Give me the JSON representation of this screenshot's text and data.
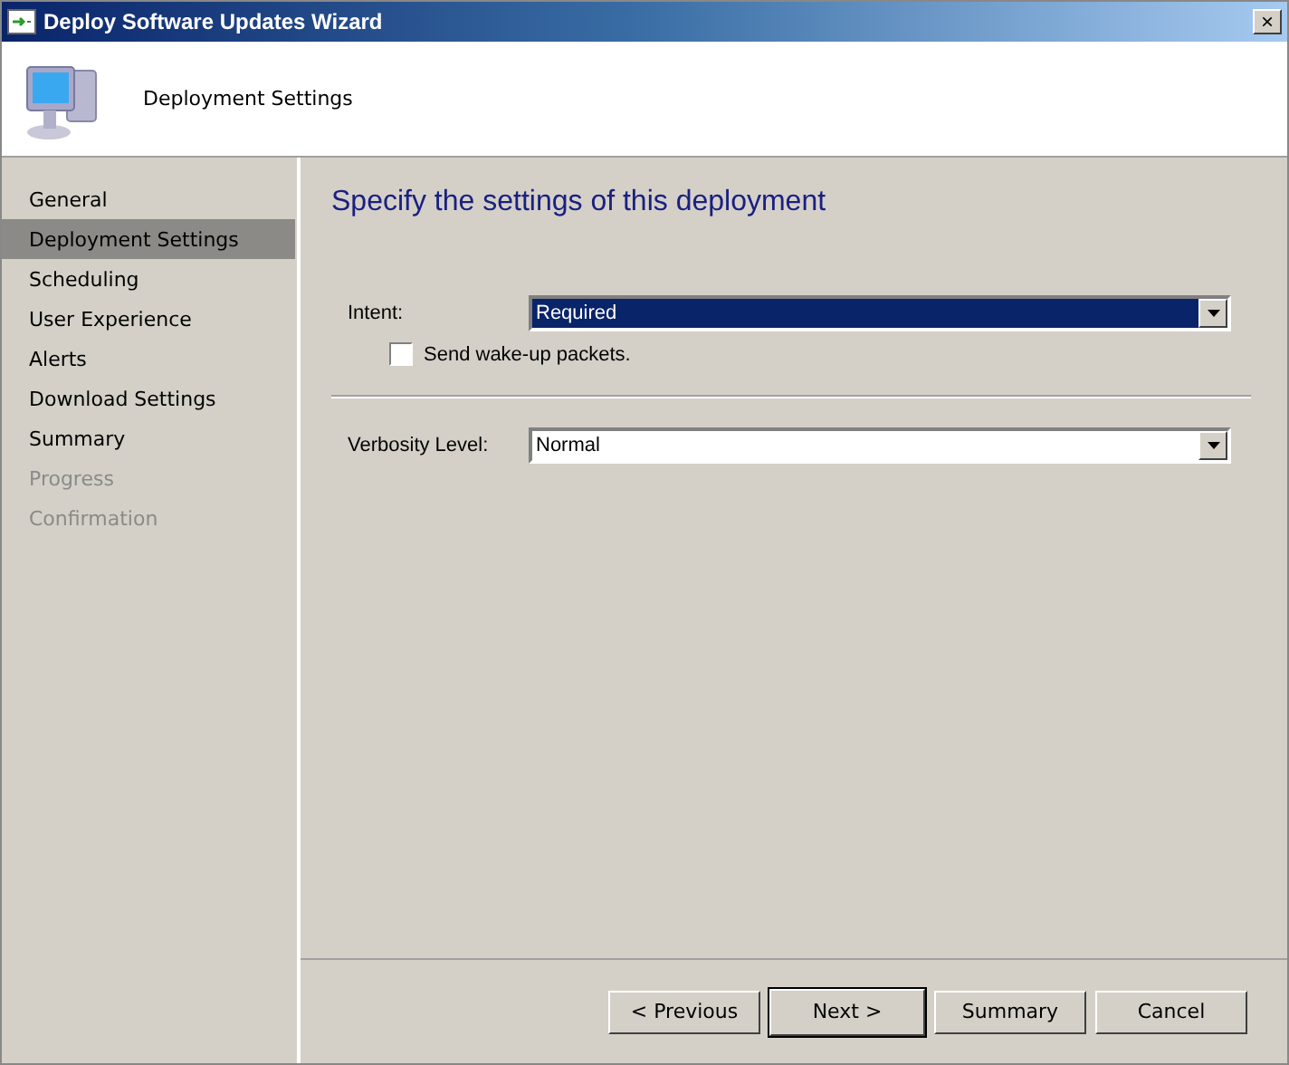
{
  "window": {
    "title": "Deploy Software Updates Wizard",
    "close": "×"
  },
  "header": {
    "title": "Deployment Settings"
  },
  "sidebar": {
    "items": [
      {
        "label": "General",
        "selected": false,
        "disabled": false
      },
      {
        "label": "Deployment Settings",
        "selected": true,
        "disabled": false
      },
      {
        "label": "Scheduling",
        "selected": false,
        "disabled": false
      },
      {
        "label": "User Experience",
        "selected": false,
        "disabled": false
      },
      {
        "label": "Alerts",
        "selected": false,
        "disabled": false
      },
      {
        "label": "Download Settings",
        "selected": false,
        "disabled": false
      },
      {
        "label": "Summary",
        "selected": false,
        "disabled": false
      },
      {
        "label": "Progress",
        "selected": false,
        "disabled": true
      },
      {
        "label": "Confirmation",
        "selected": false,
        "disabled": true
      }
    ]
  },
  "page": {
    "heading": "Specify the settings of this deployment",
    "intent": {
      "label": "Intent:",
      "value": "Required",
      "highlighted": true
    },
    "wake_up": {
      "label": "Send wake-up packets.",
      "checked": false
    },
    "verbosity": {
      "label": "Verbosity Level:",
      "value": "Normal",
      "highlighted": false
    }
  },
  "buttons": [
    {
      "label": "< Previous",
      "default": false
    },
    {
      "label": "Next >",
      "default": true
    },
    {
      "label": "Summary",
      "default": false
    },
    {
      "label": "Cancel",
      "default": false
    }
  ]
}
